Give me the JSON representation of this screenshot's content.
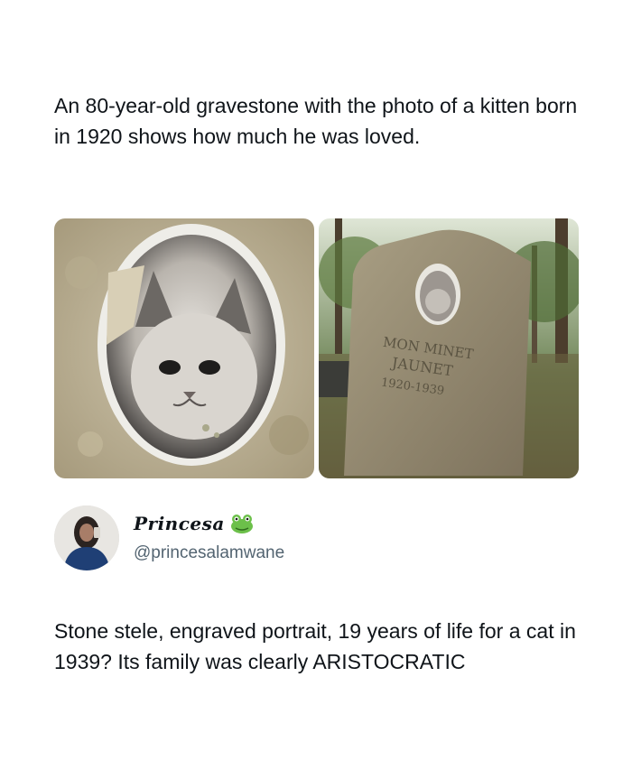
{
  "post": {
    "text": "An 80-year-old gravestone with the photo of a kitten born in 1920 shows how much he was loved."
  },
  "media": {
    "photos": [
      {
        "icon": "kitten-portrait-closeup"
      },
      {
        "icon": "gravestone-in-cemetery",
        "engraving_line1": "MON MINET",
        "engraving_line2": "JAUNET",
        "engraving_line3": "1920-1939"
      }
    ]
  },
  "author": {
    "display_name": "Princesa",
    "emoji": "frog-icon",
    "handle": "@princesalamwane"
  },
  "reply": {
    "text": "Stone stele, engraved portrait, 19 years of life for a cat in 1939? Its family was clearly ARISTOCRATIC"
  },
  "colors": {
    "text": "#0f1419",
    "secondary": "#536471",
    "background": "#ffffff"
  }
}
